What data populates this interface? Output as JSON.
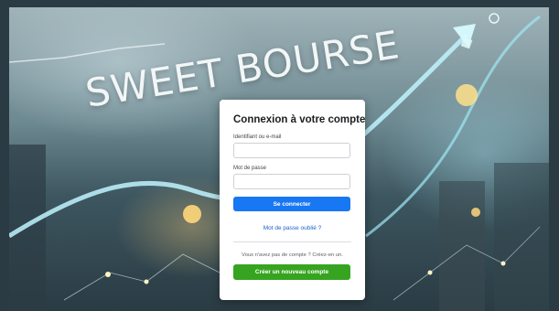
{
  "background": {
    "headline": "SWEET BOURSE"
  },
  "login": {
    "title": "Connexion à votre compte",
    "identifier_label": "Identifiant ou e-mail",
    "identifier_value": "",
    "password_label": "Mot de passe",
    "password_value": "",
    "submit_label": "Se connecter",
    "forgot_label": "Mot de passe oublié ?",
    "no_account_text": "Vous n'avez pas de compte ? Créez-en un.",
    "create_label": "Créer un nouveau compte"
  },
  "colors": {
    "primary": "#1877f2",
    "success": "#36a420",
    "link": "#1a63c9"
  }
}
